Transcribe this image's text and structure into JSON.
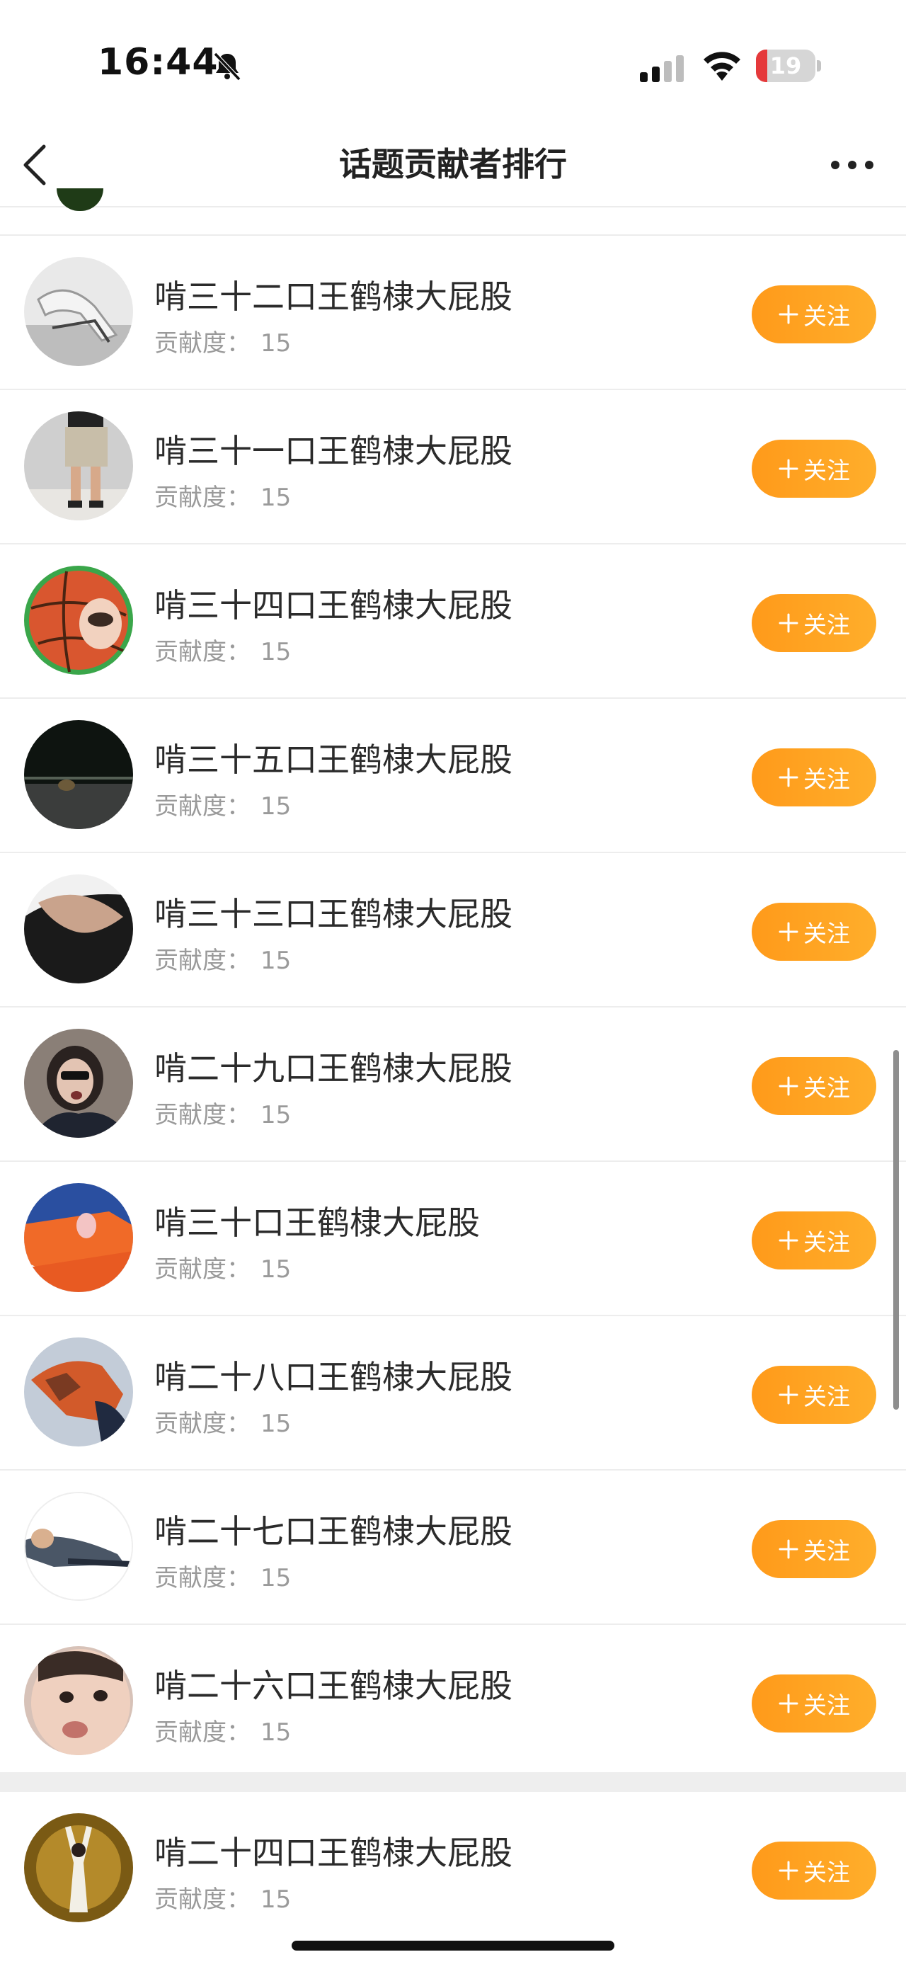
{
  "status_bar": {
    "time": "16:44",
    "battery_level": "19",
    "battery_fraction": 0.19,
    "battery_color": "#e5393b",
    "icons": [
      "bell-muted-icon",
      "cellular-signal-icon",
      "wifi-icon",
      "battery-icon"
    ]
  },
  "nav": {
    "title": "话题贡献者排行",
    "back_icon": "chevron-left-icon",
    "more_icon": "more-dots-icon"
  },
  "accent_color": "#ff9f1f",
  "contributors": [
    {
      "name": "啃三十二口王鹤棣大屁股",
      "contrib_label": "贡献度：",
      "contrib_value": "15",
      "follow_label": "关注"
    },
    {
      "name": "啃三十一口王鹤棣大屁股",
      "contrib_label": "贡献度：",
      "contrib_value": "15",
      "follow_label": "关注"
    },
    {
      "name": "啃三十四口王鹤棣大屁股",
      "contrib_label": "贡献度：",
      "contrib_value": "15",
      "follow_label": "关注"
    },
    {
      "name": "啃三十五口王鹤棣大屁股",
      "contrib_label": "贡献度：",
      "contrib_value": "15",
      "follow_label": "关注"
    },
    {
      "name": "啃三十三口王鹤棣大屁股",
      "contrib_label": "贡献度：",
      "contrib_value": "15",
      "follow_label": "关注"
    },
    {
      "name": "啃二十九口王鹤棣大屁股",
      "contrib_label": "贡献度：",
      "contrib_value": "15",
      "follow_label": "关注"
    },
    {
      "name": "啃三十口王鹤棣大屁股",
      "contrib_label": "贡献度：",
      "contrib_value": "15",
      "follow_label": "关注"
    },
    {
      "name": "啃二十八口王鹤棣大屁股",
      "contrib_label": "贡献度：",
      "contrib_value": "15",
      "follow_label": "关注"
    },
    {
      "name": "啃二十七口王鹤棣大屁股",
      "contrib_label": "贡献度：",
      "contrib_value": "15",
      "follow_label": "关注"
    },
    {
      "name": "啃二十六口王鹤棣大屁股",
      "contrib_label": "贡献度：",
      "contrib_value": "15",
      "follow_label": "关注"
    },
    {
      "name": "啃二十四口王鹤棣大屁股",
      "contrib_label": "贡献度：",
      "contrib_value": "15",
      "follow_label": "关注"
    }
  ]
}
